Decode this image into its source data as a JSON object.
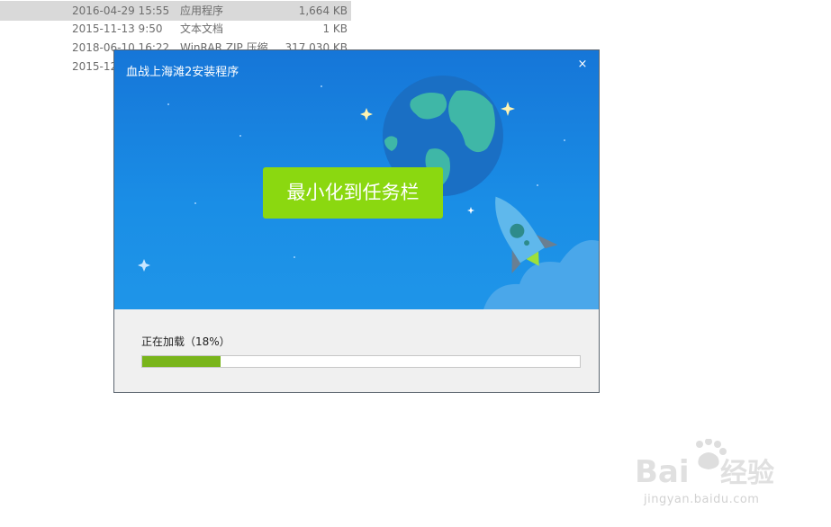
{
  "file_list": [
    {
      "date": "2016-04-29 15:55",
      "type": "应用程序",
      "size": "1,664 KB",
      "selected": true
    },
    {
      "date": "2015-11-13 9:50",
      "type": "文本文档",
      "size": "1 KB",
      "selected": false
    },
    {
      "date": "2018-06-10 16:22",
      "type": "WinRAR ZIP 压缩...",
      "size": "317,030 KB",
      "selected": false
    },
    {
      "date": "2015-12...",
      "type": "",
      "size": "",
      "selected": false
    }
  ],
  "dialog": {
    "title": "血战上海滩2安装程序",
    "close_glyph": "×",
    "minimize_label": "最小化到任务栏",
    "status_text": "正在加载（18%）",
    "progress": 0.18
  },
  "watermark": {
    "subtext": "jingyan.baidu.com"
  },
  "colors": {
    "banner_top": "#1676d8",
    "button": "#8bd810",
    "progress": "#79b51b"
  }
}
